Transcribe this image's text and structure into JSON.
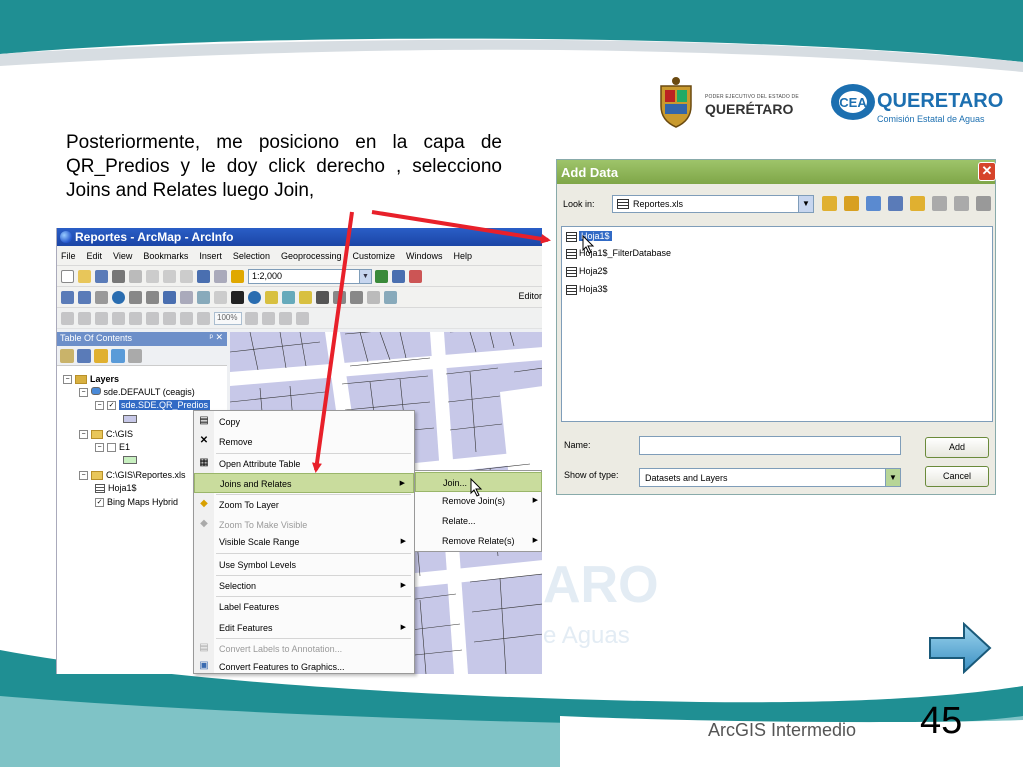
{
  "slide": {
    "caption": "Posteriormente, me posiciono en la capa de QR_Predios y le doy click derecho , selecciono Joins and Relates luego Join,",
    "footer_title": "ArcGIS Intermedio",
    "page_number": "45",
    "watermark_line1": "ARO",
    "watermark_line2": "e Aguas"
  },
  "logos": {
    "queretaro_small": "PODER EJECUTIVO DEL ESTADO DE",
    "queretaro_big": "QUERÉTARO",
    "cea_name": "QUERETARO",
    "cea_sub": "Comisión Estatal de Aguas"
  },
  "arcmap": {
    "title": "Reportes - ArcMap - ArcInfo",
    "menu": [
      "File",
      "Edit",
      "View",
      "Bookmarks",
      "Insert",
      "Selection",
      "Geoprocessing",
      "Customize",
      "Windows",
      "Help"
    ],
    "scale": "1:2,000",
    "zoom": "100%",
    "editor_label": "Editor",
    "toc": {
      "title": "Table Of Contents",
      "layers_label": "Layers",
      "db_connection": "sde.DEFAULT (ceagis)",
      "selected_layer": "sde.SDE.QR_Predios",
      "folder_gis": "C:\\GIS",
      "layer_e1": "E1",
      "folder_reportes": "C:\\GIS\\Reportes.xls",
      "table_hoja1": "Hoja1$",
      "basemap": "Bing Maps Hybrid"
    }
  },
  "context_menu": {
    "items": [
      {
        "label": "Copy"
      },
      {
        "label": "Remove"
      },
      {
        "label": "Open Attribute Table"
      },
      {
        "label": "Joins and Relates"
      },
      {
        "label": "Zoom To Layer"
      },
      {
        "label": "Zoom To Make Visible"
      },
      {
        "label": "Visible Scale Range"
      },
      {
        "label": "Use Symbol Levels"
      },
      {
        "label": "Selection"
      },
      {
        "label": "Label Features"
      },
      {
        "label": "Edit Features"
      },
      {
        "label": "Convert Labels to Annotation..."
      },
      {
        "label": "Convert Features to Graphics..."
      }
    ],
    "submenu": [
      {
        "label": "Join..."
      },
      {
        "label": "Remove Join(s)"
      },
      {
        "label": "Relate..."
      },
      {
        "label": "Remove Relate(s)"
      }
    ]
  },
  "add_data": {
    "title": "Add Data",
    "look_in_label": "Look in:",
    "look_in_value": "Reportes.xls",
    "items": [
      "Hoja1$",
      "Hoja1$_FilterDatabase",
      "Hoja2$",
      "Hoja3$"
    ],
    "name_label": "Name:",
    "name_value": "",
    "type_label": "Show of type:",
    "type_value": "Datasets and Layers",
    "add_button": "Add",
    "cancel_button": "Cancel"
  },
  "colors": {
    "accent_band": "#1f8f93",
    "annotation_arrow": "#e8202a",
    "dialog_title": "#8db35a",
    "menu_highlight": "#c9dc9d",
    "map_fill": "#c7c8e8"
  }
}
